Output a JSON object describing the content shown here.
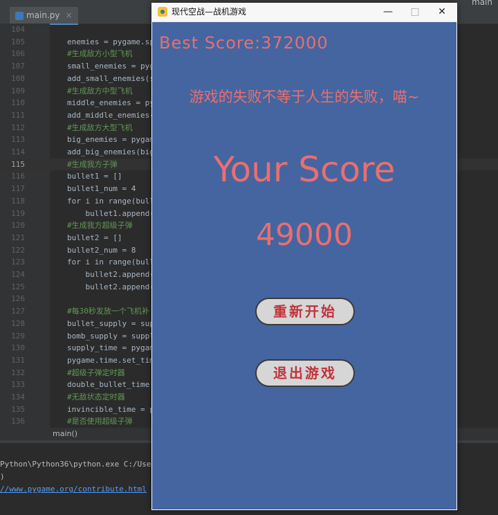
{
  "ide": {
    "tab_label": "main.py",
    "tab_close": "×",
    "branch": "main",
    "lines": [
      {
        "num": "104",
        "text": "",
        "type": "code"
      },
      {
        "num": "105",
        "text": "enemies = pygame.spr",
        "type": "code"
      },
      {
        "num": "106",
        "text": "#生成敌方小型飞机",
        "type": "comment"
      },
      {
        "num": "107",
        "text": "small_enemies = pyga",
        "type": "code"
      },
      {
        "num": "108",
        "text": "add_small_enemies(sm",
        "type": "code"
      },
      {
        "num": "109",
        "text": "#生成敌方中型飞机",
        "type": "comment"
      },
      {
        "num": "110",
        "text": "middle_enemies = pyg",
        "type": "code"
      },
      {
        "num": "111",
        "text": "add_middle_enemies(m",
        "type": "code"
      },
      {
        "num": "112",
        "text": "#生成敌方大型飞机",
        "type": "comment"
      },
      {
        "num": "113",
        "text": "big_enemies = pygame",
        "type": "code"
      },
      {
        "num": "114",
        "text": "add_big_enemies(big_",
        "type": "code"
      },
      {
        "num": "115",
        "text": "#生成我方子弹",
        "type": "comment"
      },
      {
        "num": "116",
        "text": "bullet1 = []",
        "type": "code"
      },
      {
        "num": "117",
        "text": "bullet1_num = 4",
        "type": "code"
      },
      {
        "num": "118",
        "text": "for i in range(bulle",
        "type": "code"
      },
      {
        "num": "119",
        "text": "    bullet1.append(m",
        "type": "code"
      },
      {
        "num": "120",
        "text": "#生成我方超级子弹",
        "type": "comment"
      },
      {
        "num": "121",
        "text": "bullet2 = []",
        "type": "code"
      },
      {
        "num": "122",
        "text": "bullet2_num = 8",
        "type": "code"
      },
      {
        "num": "123",
        "text": "for i in range(bulle",
        "type": "code"
      },
      {
        "num": "124",
        "text": "    bullet2.append(m",
        "type": "code"
      },
      {
        "num": "125",
        "text": "    bullet2.append(m",
        "type": "code"
      },
      {
        "num": "126",
        "text": "",
        "type": "code"
      },
      {
        "num": "127",
        "text": "#每30秒发放一个飞机补",
        "type": "comment"
      },
      {
        "num": "128",
        "text": "bullet_supply = supp",
        "type": "code"
      },
      {
        "num": "129",
        "text": "bomb_supply = supply",
        "type": "code"
      },
      {
        "num": "130",
        "text": "supply_time = pygame",
        "type": "code"
      },
      {
        "num": "131",
        "text": "pygame.time.set_time",
        "type": "code"
      },
      {
        "num": "132",
        "text": "#超级子弹定时器",
        "type": "comment"
      },
      {
        "num": "133",
        "text": "double_bullet_time =",
        "type": "code"
      },
      {
        "num": "134",
        "text": "#无敌状态定时器",
        "type": "comment"
      },
      {
        "num": "135",
        "text": "invincible_time = py",
        "type": "code"
      },
      {
        "num": "136",
        "text": "#是否使用超级子弹",
        "type": "comment"
      }
    ],
    "breadcrumb": "main()",
    "console_lines": [
      "Python\\Python36\\python.exe C:/Users/",
      ")",
      "//www.pygame.org/contribute.html"
    ]
  },
  "window": {
    "title": "现代空战—战机游戏",
    "minimize": "—",
    "maximize": "□",
    "close": "✕"
  },
  "game": {
    "best_score_label": "Best Score:372000",
    "motto": "游戏的失败不等于人生的失败，喵~",
    "your_score_label": "Your Score",
    "score_value": "49000",
    "restart_button": "重新开始",
    "exit_button": "退出游戏"
  }
}
